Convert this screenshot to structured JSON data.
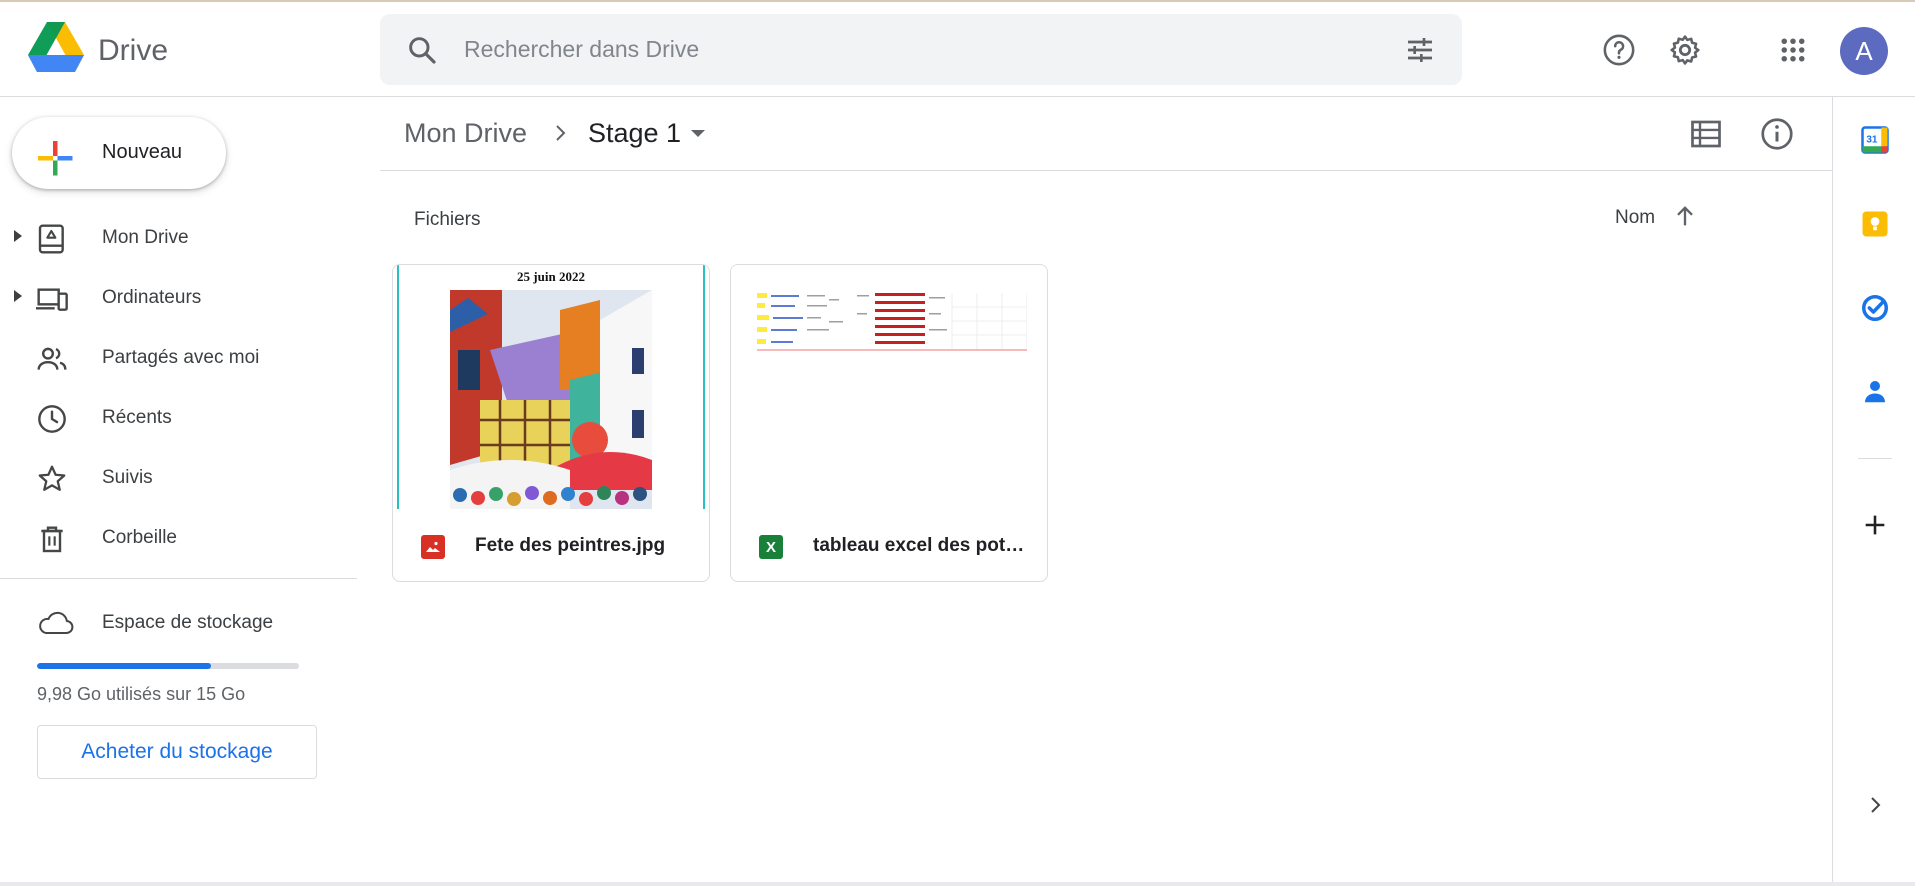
{
  "header": {
    "brand": "Drive",
    "search_placeholder": "Rechercher dans Drive",
    "avatar_letter": "A"
  },
  "sidebar": {
    "new_label": "Nouveau",
    "items": [
      {
        "label": "Mon Drive",
        "icon": "my-drive-icon",
        "expandable": true
      },
      {
        "label": "Ordinateurs",
        "icon": "computers-icon",
        "expandable": true
      },
      {
        "label": "Partagés avec moi",
        "icon": "shared-icon",
        "expandable": false
      },
      {
        "label": "Récents",
        "icon": "clock-icon",
        "expandable": false
      },
      {
        "label": "Suivis",
        "icon": "star-icon",
        "expandable": false
      },
      {
        "label": "Corbeille",
        "icon": "trash-icon",
        "expandable": false
      }
    ],
    "storage": {
      "label": "Espace de stockage",
      "usage_text": "9,98 Go utilisés sur 15 Go",
      "used_fraction": 0.665,
      "buy_label": "Acheter du stockage"
    }
  },
  "main": {
    "breadcrumb": {
      "root": "Mon Drive",
      "current": "Stage 1"
    },
    "section_label": "Fichiers",
    "sort_label": "Nom",
    "files": [
      {
        "name": "Fete des peintres.jpg",
        "type": "image",
        "type_color": "#d93025",
        "thumb_title": "25 juin 2022"
      },
      {
        "name": "tableau excel des pote…",
        "type": "spreadsheet",
        "type_color": "#188038",
        "type_letter": "X"
      }
    ]
  },
  "colors": {
    "accent": "#1a73e8",
    "avatar": "#5c6bc0"
  }
}
